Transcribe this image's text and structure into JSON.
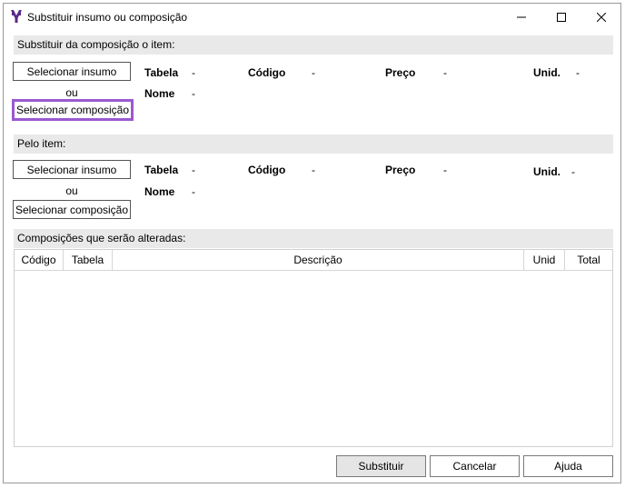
{
  "window": {
    "title": "Substituir insumo ou composição",
    "controls": [
      "minimize-icon",
      "maximize-icon",
      "close-icon"
    ],
    "accent_color": "#5b2a86"
  },
  "section1": {
    "header": "Substituir da composição o item:",
    "btn_insumo": "Selecionar insumo",
    "ou": "ou",
    "btn_composicao": "Selecionar composição",
    "highlight_color": "#9b59d0",
    "fields": {
      "tabela_label": "Tabela",
      "tabela_value": "-",
      "codigo_label": "Código",
      "codigo_value": "-",
      "preco_label": "Preço",
      "preco_value": "-",
      "unid_label": "Unid.",
      "unid_value": "-",
      "nome_label": "Nome",
      "nome_value": "-"
    }
  },
  "section2": {
    "header": "Pelo item:",
    "btn_insumo": "Selecionar insumo",
    "ou": "ou",
    "btn_composicao": "Selecionar composição",
    "fields": {
      "tabela_label": "Tabela",
      "tabela_value": "-",
      "codigo_label": "Código",
      "codigo_value": "-",
      "preco_label": "Preço",
      "preco_value": "-",
      "unid_label": "Unid.",
      "unid_value": "-",
      "nome_label": "Nome",
      "nome_value": "-"
    }
  },
  "section3": {
    "header": "Composições que serão alteradas:",
    "columns": [
      "Código",
      "Tabela",
      "Descrição",
      "Unid",
      "Total"
    ],
    "rows": []
  },
  "footer": {
    "substituir": "Substituir",
    "cancelar": "Cancelar",
    "ajuda": "Ajuda"
  }
}
